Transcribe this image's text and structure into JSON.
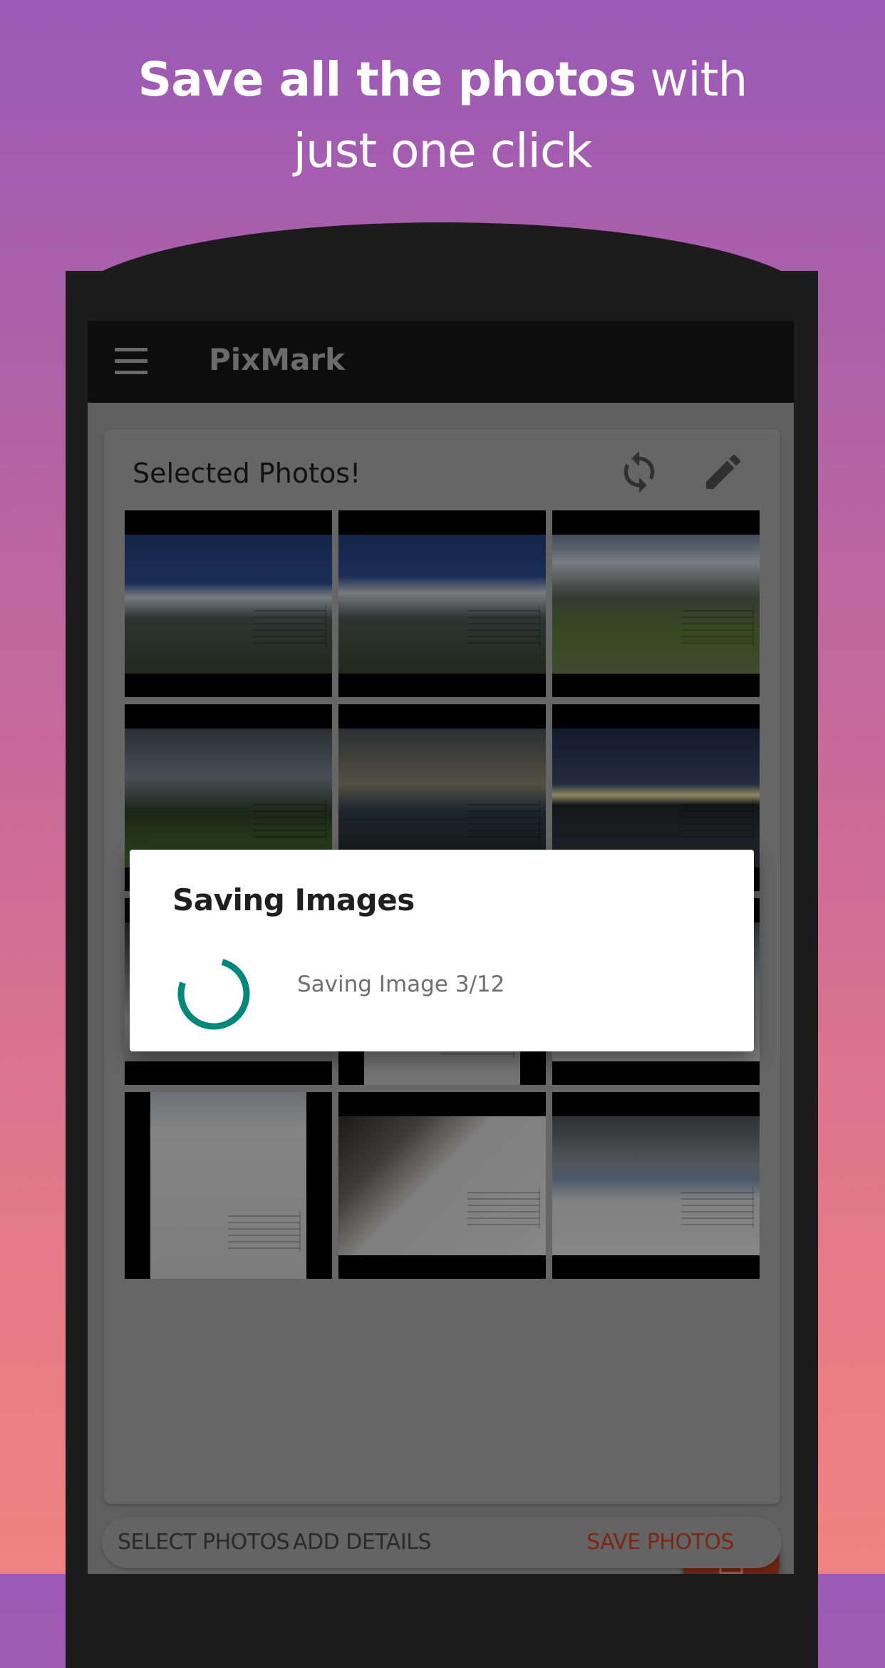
{
  "promo": {
    "headline_bold": "Save all the photos",
    "headline_light_1": " with",
    "headline_light_2": "just one click"
  },
  "app": {
    "title": "PixMark",
    "menu_icon": "hamburger-menu-icon"
  },
  "card": {
    "title": "Selected Photos!",
    "actions": [
      {
        "name": "refresh",
        "icon": "sync-icon"
      },
      {
        "name": "edit",
        "icon": "pencil-icon"
      }
    ],
    "photos": [
      {
        "subject": "Mountain range with clouds",
        "orientation": "landscape"
      },
      {
        "subject": "Mountain range with clouds",
        "orientation": "landscape"
      },
      {
        "subject": "Hiker on meadow below mountains",
        "orientation": "landscape"
      },
      {
        "subject": "Person in forest meadow",
        "orientation": "landscape"
      },
      {
        "subject": "Cloudy valley at dusk",
        "orientation": "landscape"
      },
      {
        "subject": "Sunset over ridge",
        "orientation": "landscape"
      },
      {
        "subject": "Snow slope",
        "orientation": "landscape"
      },
      {
        "subject": "Snow trail",
        "orientation": "portrait"
      },
      {
        "subject": "Snowy ridge",
        "orientation": "landscape"
      },
      {
        "subject": "Climber on snow slope",
        "orientation": "portrait"
      },
      {
        "subject": "Hikers on snowfield",
        "orientation": "landscape"
      },
      {
        "subject": "Snow valley under clouds",
        "orientation": "landscape"
      }
    ]
  },
  "dialog": {
    "title": "Saving Images",
    "message": "Saving Image 3/12",
    "current": 3,
    "total": 12,
    "spinner_color": "#00897b"
  },
  "fab": {
    "icon": "download-icon"
  },
  "bottom_nav": {
    "items": [
      {
        "label": "SELECT PHOTOS",
        "active": false
      },
      {
        "label": "ADD DETAILS",
        "active": false
      },
      {
        "label": "SAVE PHOTOS",
        "active": true
      }
    ]
  },
  "colors": {
    "accent": "#e64a19",
    "spinner": "#00897b",
    "bg_top": "#9b59b6",
    "bg_bottom": "#f0827f"
  }
}
